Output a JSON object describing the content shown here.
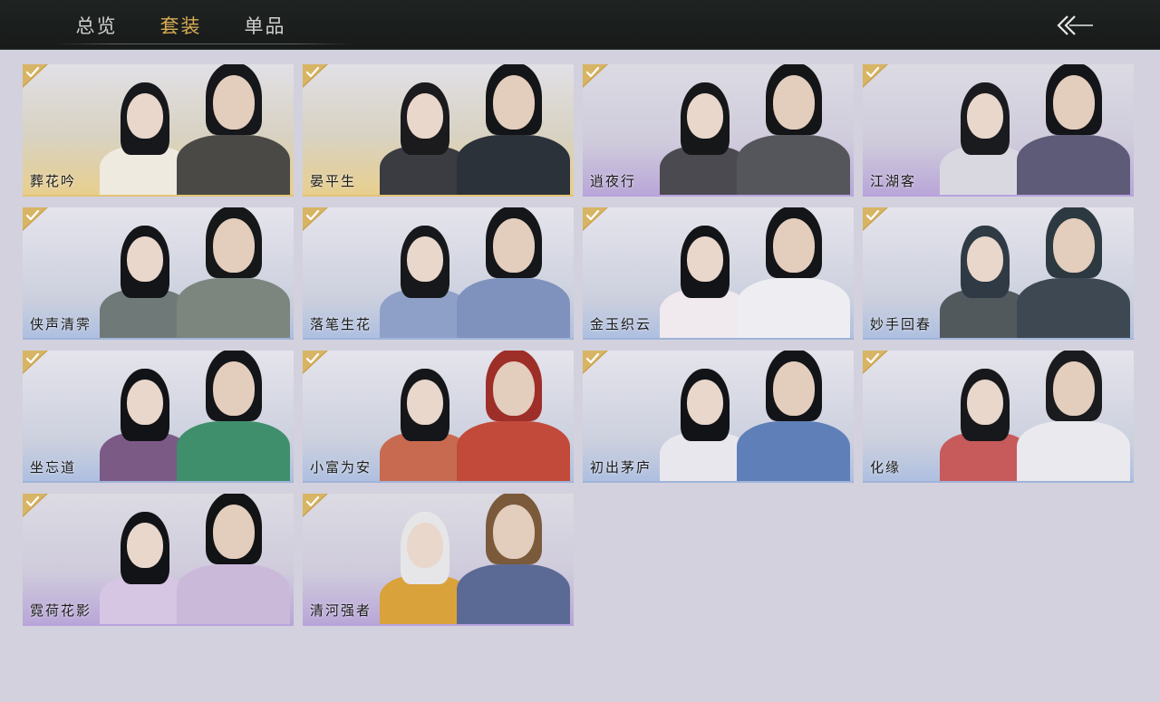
{
  "tabs": [
    {
      "label": "总览",
      "active": false
    },
    {
      "label": "套装",
      "active": true
    },
    {
      "label": "单品",
      "active": false
    }
  ],
  "back_icon": "back-arrow-icon",
  "colors": {
    "accent": "#d9ad55",
    "background": "#d2d1dd",
    "topbar": "#1b1e1d"
  },
  "outfits": [
    {
      "name": "葬花吟",
      "owned": true,
      "tint": "gold",
      "female": {
        "hair": "#17181c",
        "robe": "#efeae0"
      },
      "male": {
        "hair": "#16171a",
        "robe": "#4a4946"
      }
    },
    {
      "name": "晏平生",
      "owned": true,
      "tint": "gold",
      "female": {
        "hair": "#1b1b1e",
        "robe": "#3a3c42"
      },
      "male": {
        "hair": "#141518",
        "robe": "#2c323a"
      }
    },
    {
      "name": "逍夜行",
      "owned": true,
      "tint": "purple",
      "female": {
        "hair": "#161719",
        "robe": "#4b4a50"
      },
      "male": {
        "hair": "#141517",
        "robe": "#55565b"
      }
    },
    {
      "name": "江湖客",
      "owned": true,
      "tint": "purple",
      "female": {
        "hair": "#1a1b1f",
        "robe": "#d9d8e0"
      },
      "male": {
        "hair": "#141519",
        "robe": "#5e5b79"
      }
    },
    {
      "name": "侠声清霁",
      "owned": true,
      "tint": "bluebase",
      "female": {
        "hair": "#141518",
        "robe": "#6f7a78"
      },
      "male": {
        "hair": "#161719",
        "robe": "#7d857f"
      }
    },
    {
      "name": "落笔生花",
      "owned": true,
      "tint": "bluebase",
      "female": {
        "hair": "#17181b",
        "robe": "#8ea0c7"
      },
      "male": {
        "hair": "#151619",
        "robe": "#7e92bd"
      }
    },
    {
      "name": "金玉织云",
      "owned": true,
      "tint": "bluebase",
      "female": {
        "hair": "#131417",
        "robe": "#f0e9ee"
      },
      "male": {
        "hair": "#141518",
        "robe": "#eeeef2"
      }
    },
    {
      "name": "妙手回春",
      "owned": true,
      "tint": "bluebase",
      "female": {
        "hair": "#2f3a44",
        "robe": "#51595d"
      },
      "male": {
        "hair": "#2d3940",
        "robe": "#3d4852"
      }
    },
    {
      "name": "坐忘道",
      "owned": true,
      "tint": "bluebase",
      "female": {
        "hair": "#121316",
        "robe": "#7b5a86"
      },
      "male": {
        "hair": "#141518",
        "robe": "#3f8f6d"
      }
    },
    {
      "name": "小富为安",
      "owned": true,
      "tint": "bluebase",
      "female": {
        "hair": "#15161a",
        "robe": "#c86a50"
      },
      "male": {
        "hair": "#9e2e28",
        "robe": "#c14a3a"
      }
    },
    {
      "name": "初出茅庐",
      "owned": true,
      "tint": "bluebase",
      "female": {
        "hair": "#121317",
        "robe": "#e9e7ee"
      },
      "male": {
        "hair": "#131418",
        "robe": "#5f7fb8"
      }
    },
    {
      "name": "化缘",
      "owned": true,
      "tint": "bluebase",
      "female": {
        "hair": "#17181b",
        "robe": "#c75a5a"
      },
      "male": {
        "hair": "#1a1b1e",
        "robe": "#e9e9ee"
      }
    },
    {
      "name": "霓荷花影",
      "owned": true,
      "tint": "purple",
      "female": {
        "hair": "#121316",
        "robe": "#d6c6e4"
      },
      "male": {
        "hair": "#121315",
        "robe": "#cbb9d9"
      }
    },
    {
      "name": "清河强者",
      "owned": true,
      "tint": "purple",
      "female": {
        "hair": "#e6e6e8",
        "robe": "#d9a23a"
      },
      "male": {
        "hair": "#7a5a3a",
        "robe": "#5b6a94"
      }
    }
  ]
}
